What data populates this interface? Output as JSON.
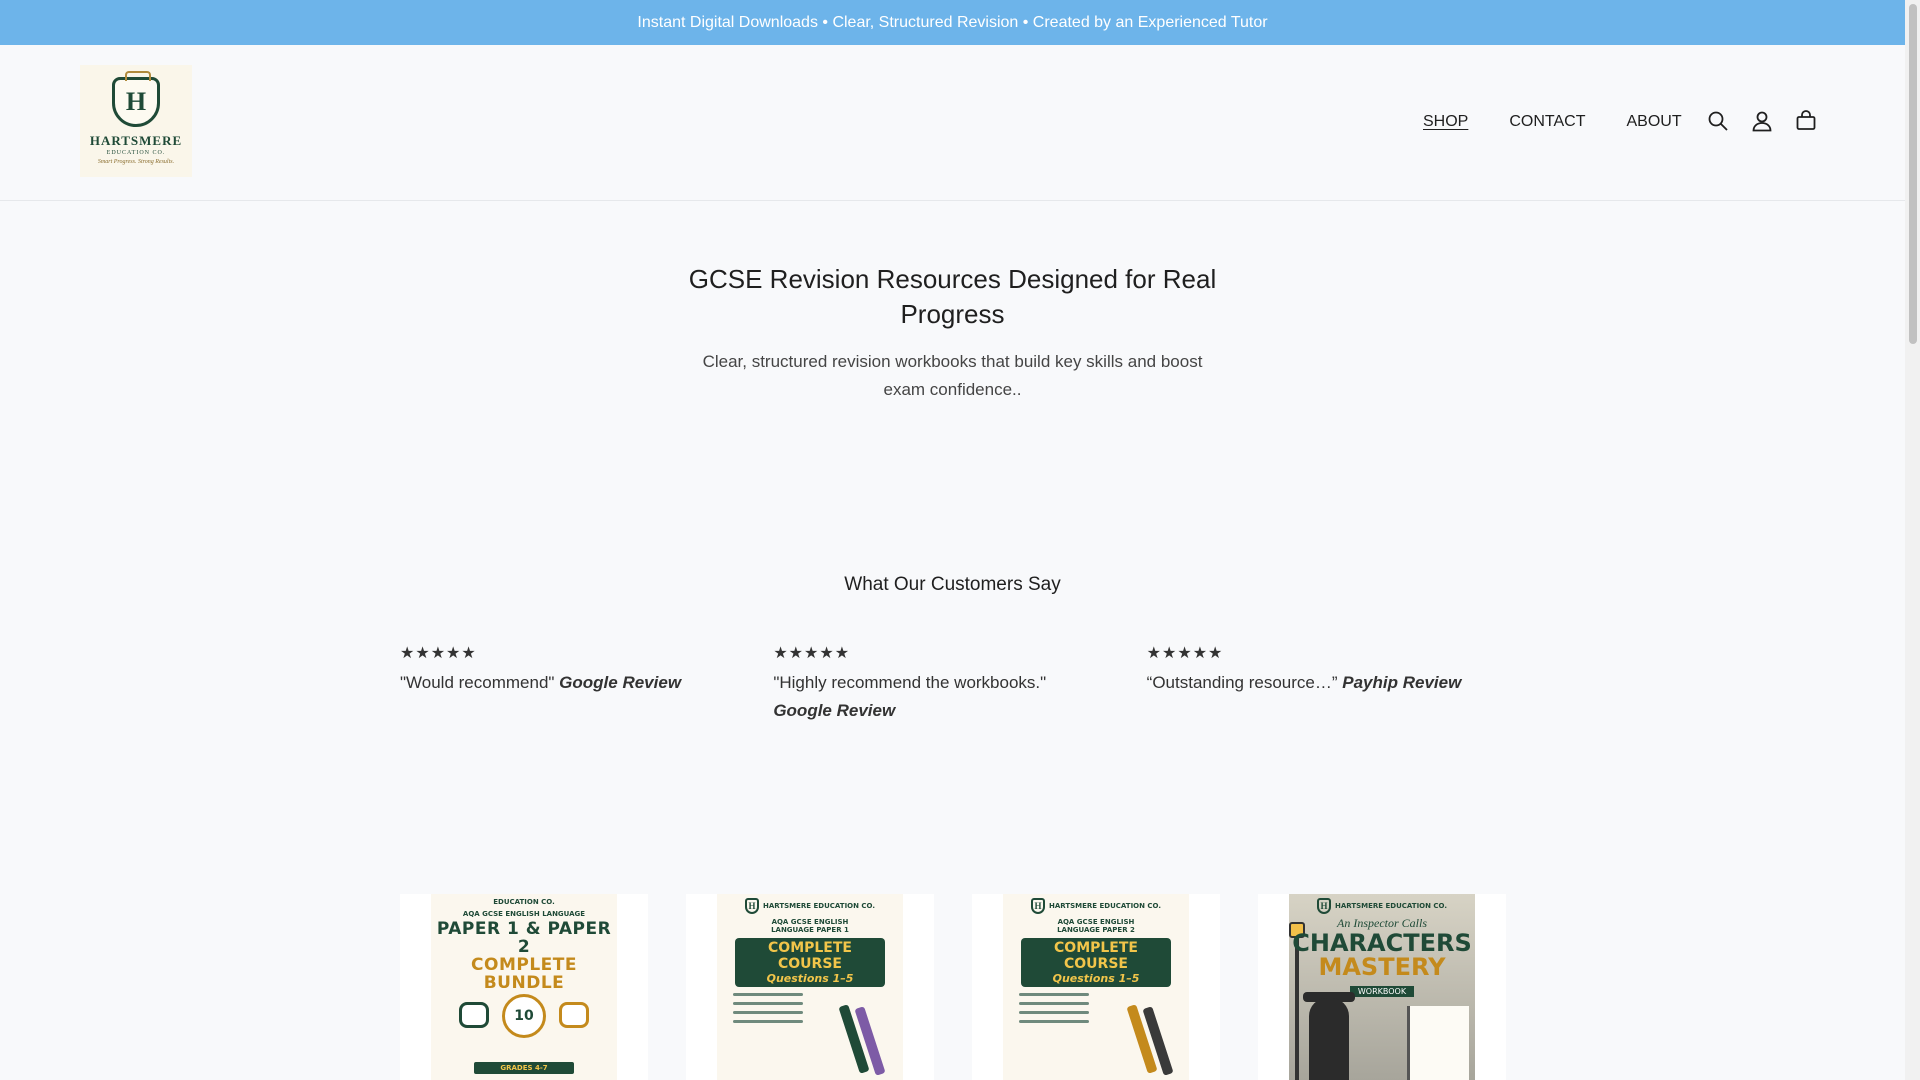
{
  "announcement": {
    "text": "Instant Digital Downloads • Clear, Structured Revision • Created by an Experienced Tutor"
  },
  "logo": {
    "letter": "H",
    "name": "HARTSMERE",
    "subtitle": "EDUCATION CO.",
    "tagline": "Smart Progress. Strong Results."
  },
  "nav": {
    "items": [
      {
        "label": "SHOP",
        "active": true
      },
      {
        "label": "CONTACT",
        "active": false
      },
      {
        "label": "ABOUT",
        "active": false
      }
    ]
  },
  "header_icons": [
    "search-icon",
    "account-icon",
    "cart-icon"
  ],
  "hero": {
    "title": "GCSE Revision Resources Designed for Real Progress",
    "subtitle": "Clear, structured revision workbooks that build key skills and boost exam confidence.."
  },
  "reviews": {
    "title": "What Our Customers Say",
    "items": [
      {
        "stars": "★★★★★",
        "quote": "\"Would recommend\"",
        "source": "Google Review"
      },
      {
        "stars": "★★★★★",
        "quote": "\"Highly recommend the workbooks.\"",
        "source": "Google Review"
      },
      {
        "stars": "★★★★★",
        "quote": "“Outstanding resource…”",
        "source": "Payhip Review"
      }
    ]
  },
  "products": [
    {
      "brand": "EDUCATION CO.",
      "kicker": "AQA GCSE ENGLISH LANGUAGE",
      "title_line1": "PAPER 1 & PAPER 2",
      "title_line2": "COMPLETE BUNDLE",
      "badge": "10",
      "grade": "GRADES 4-7"
    },
    {
      "brand": "HARTSMERE EDUCATION CO.",
      "kicker": "AQA GCSE ENGLISH LANGUAGE PAPER 1",
      "band": "COMPLETE COURSE",
      "band_sub": "Questions 1–5"
    },
    {
      "brand": "HARTSMERE EDUCATION CO.",
      "kicker": "AQA GCSE ENGLISH LANGUAGE PAPER 2",
      "band": "COMPLETE COURSE",
      "band_sub": "Questions 1–5"
    },
    {
      "brand": "HARTSMERE EDUCATION CO.",
      "kicker": "An Inspector Calls",
      "title_line1": "CHARACTERS",
      "title_line2": "MASTERY",
      "band": "WORKBOOK"
    }
  ],
  "colors": {
    "announcement_bg": "#6db4ea",
    "page_bg": "#f8f9fb",
    "brand_green": "#1f4a37",
    "brand_gold": "#c48a1c"
  }
}
